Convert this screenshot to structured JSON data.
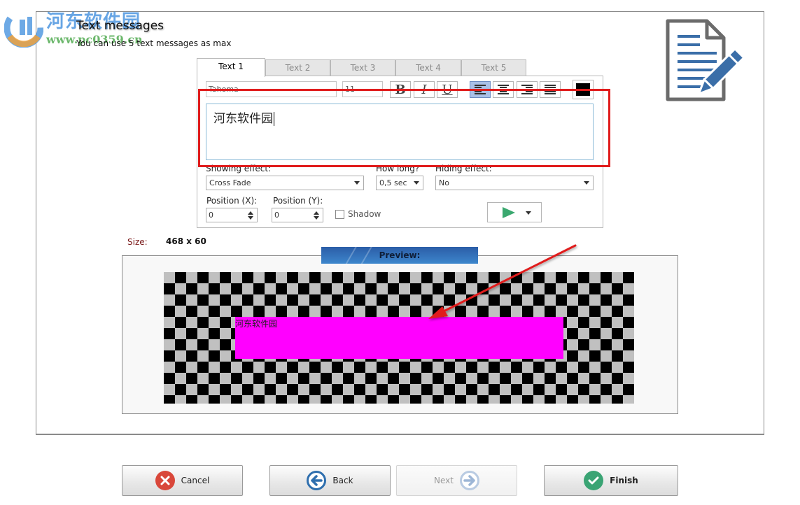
{
  "watermark": {
    "site_name": "河东软件园",
    "url": "www.pc0359.cn"
  },
  "header": {
    "title": "Text messages",
    "subtitle": "You can use 5 text messages as max",
    "icon": "document-edit-icon"
  },
  "tabs": [
    {
      "label": "Text 1",
      "active": true
    },
    {
      "label": "Text 2",
      "active": false
    },
    {
      "label": "Text 3",
      "active": false
    },
    {
      "label": "Text 4",
      "active": false
    },
    {
      "label": "Text 5",
      "active": false
    }
  ],
  "format_toolbar": {
    "font_family": "Tahoma",
    "font_size": "11",
    "bold_label": "B",
    "italic_label": "I",
    "underline_label": "U",
    "alignment": "left",
    "text_color": "#000000"
  },
  "message_text": "河东软件园",
  "effects": {
    "showing_label": "Showing effect:",
    "showing_value": "Cross Fade",
    "duration_label": "How long?",
    "duration_value": "0,5 sec",
    "hiding_label": "Hiding effect:",
    "hiding_value": "No"
  },
  "position": {
    "x_label": "Position (X):",
    "x_value": "0",
    "y_label": "Position (Y):",
    "y_value": "0",
    "shadow_label": "Shadow",
    "shadow_checked": false
  },
  "size": {
    "label": "Size:",
    "value": "468 x 60"
  },
  "preview": {
    "header": "Preview:",
    "banner_text": "河东软件园",
    "banner_color": "#ff00ff"
  },
  "annotation_color": "#e01b1b",
  "buttons": {
    "cancel": "Cancel",
    "back": "Back",
    "next": "Next",
    "finish": "Finish"
  }
}
